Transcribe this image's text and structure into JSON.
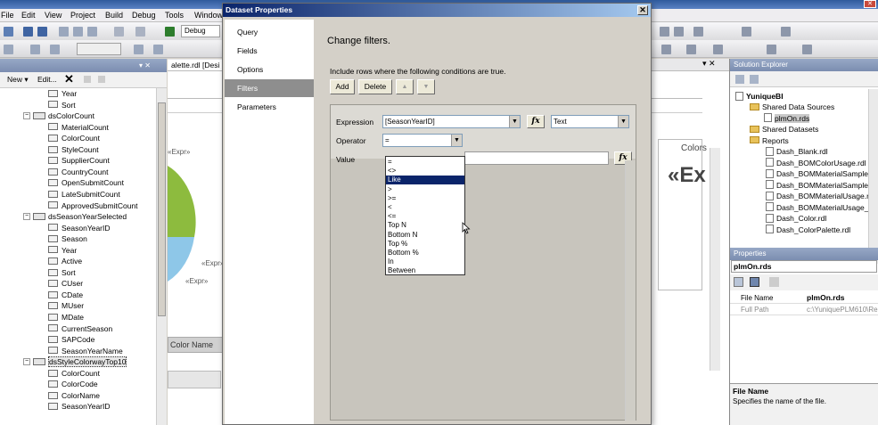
{
  "vs": {
    "title": "",
    "menu": [
      "File",
      "Edit",
      "View",
      "Project",
      "Build",
      "Debug",
      "Tools",
      "Window"
    ],
    "toolbar_config": "Debug",
    "toolbar_combo2": "",
    "designer_tab": "alette.rdl [Desi",
    "designer_expr_left": "«Expr»",
    "designer_expr_right": "«Expr»",
    "designer_expr_bottom": "«Expr»",
    "designer_colors_label": "Colors",
    "designer_big_expr": "«Ex",
    "designer_col_header": "Color Name",
    "colors": {
      "chart_green": "#8dbb3e",
      "chart_blue": "#8ec7e8",
      "title_blue": "#0a246a",
      "selection": "#0a246a"
    }
  },
  "report_data": {
    "header": "",
    "toolbar": {
      "new_label": "New",
      "edit_label": "Edit..."
    },
    "tree": [
      {
        "type": "field",
        "label": "Year"
      },
      {
        "type": "field",
        "label": "Sort"
      },
      {
        "type": "dataset",
        "label": "dsColorCount"
      },
      {
        "type": "field",
        "label": "MaterialCount"
      },
      {
        "type": "field",
        "label": "ColorCount"
      },
      {
        "type": "field",
        "label": "StyleCount"
      },
      {
        "type": "field",
        "label": "SupplierCount"
      },
      {
        "type": "field",
        "label": "CountryCount"
      },
      {
        "type": "field",
        "label": "OpenSubmitCount"
      },
      {
        "type": "field",
        "label": "LateSubmitCount"
      },
      {
        "type": "field",
        "label": "ApprovedSubmitCount"
      },
      {
        "type": "dataset",
        "label": "dsSeasonYearSelected"
      },
      {
        "type": "field",
        "label": "SeasonYearID"
      },
      {
        "type": "field",
        "label": "Season"
      },
      {
        "type": "field",
        "label": "Year"
      },
      {
        "type": "field",
        "label": "Active"
      },
      {
        "type": "field",
        "label": "Sort"
      },
      {
        "type": "field",
        "label": "CUser"
      },
      {
        "type": "field",
        "label": "CDate"
      },
      {
        "type": "field",
        "label": "MUser"
      },
      {
        "type": "field",
        "label": "MDate"
      },
      {
        "type": "field",
        "label": "CurrentSeason"
      },
      {
        "type": "field",
        "label": "SAPCode"
      },
      {
        "type": "field",
        "label": "SeasonYearName"
      },
      {
        "type": "dataset",
        "label": "dsStyleColorwayTop10",
        "selected": true
      },
      {
        "type": "field",
        "label": "ColorCount"
      },
      {
        "type": "field",
        "label": "ColorCode"
      },
      {
        "type": "field",
        "label": "ColorName"
      },
      {
        "type": "field",
        "label": "SeasonYearID"
      }
    ]
  },
  "dialog": {
    "title": "Dataset Properties",
    "close_glyph": "✕",
    "nav": [
      "Query",
      "Fields",
      "Options",
      "Filters",
      "Parameters"
    ],
    "selected_nav": "Filters",
    "heading": "Change filters.",
    "instruction": "Include rows where the following conditions are true.",
    "add_label": "Add",
    "delete_label": "Delete",
    "up_glyph": "▲",
    "down_glyph": "▼",
    "expression_label": "Expression",
    "expression_value": "[SeasonYearID]",
    "type_value": "Text",
    "operator_label": "Operator",
    "operator_value": "=",
    "value_label": "Value",
    "value_value": "",
    "fx_label": "fx",
    "operators": [
      "=",
      "<>",
      "Like",
      ">",
      ">=",
      "<",
      "<=",
      "Top N",
      "Bottom N",
      "Top %",
      "Bottom %",
      "In",
      "Between"
    ],
    "highlighted_operator": "Like"
  },
  "solution_explorer": {
    "header": "Solution Explorer",
    "project": "YuniqueBI",
    "items": [
      {
        "type": "folder",
        "label": "Shared Data Sources"
      },
      {
        "type": "file",
        "label": "plmOn.rds"
      },
      {
        "type": "folder",
        "label": "Shared Datasets"
      },
      {
        "type": "folder",
        "label": "Reports"
      },
      {
        "type": "file",
        "label": "Dash_Blank.rdl"
      },
      {
        "type": "file",
        "label": "Dash_BOMColorUsage.rdl"
      },
      {
        "type": "file",
        "label": "Dash_BOMMaterialSampleUs"
      },
      {
        "type": "file",
        "label": "Dash_BOMMaterialSampleUs"
      },
      {
        "type": "file",
        "label": "Dash_BOMMaterialUsage.rdl"
      },
      {
        "type": "file",
        "label": "Dash_BOMMaterialUsage_Su"
      },
      {
        "type": "file",
        "label": "Dash_Color.rdl"
      },
      {
        "type": "file",
        "label": "Dash_ColorPalette.rdl"
      }
    ]
  },
  "properties": {
    "header": "Properties",
    "object": "plmOn.rds",
    "rows": [
      {
        "name": "File Name",
        "value": "plmOn.rds"
      },
      {
        "name": "Full Path",
        "value": "c:\\YuniquePLM610\\Re"
      }
    ],
    "desc_title": "File Name",
    "desc_text": "Specifies the name of the file."
  }
}
